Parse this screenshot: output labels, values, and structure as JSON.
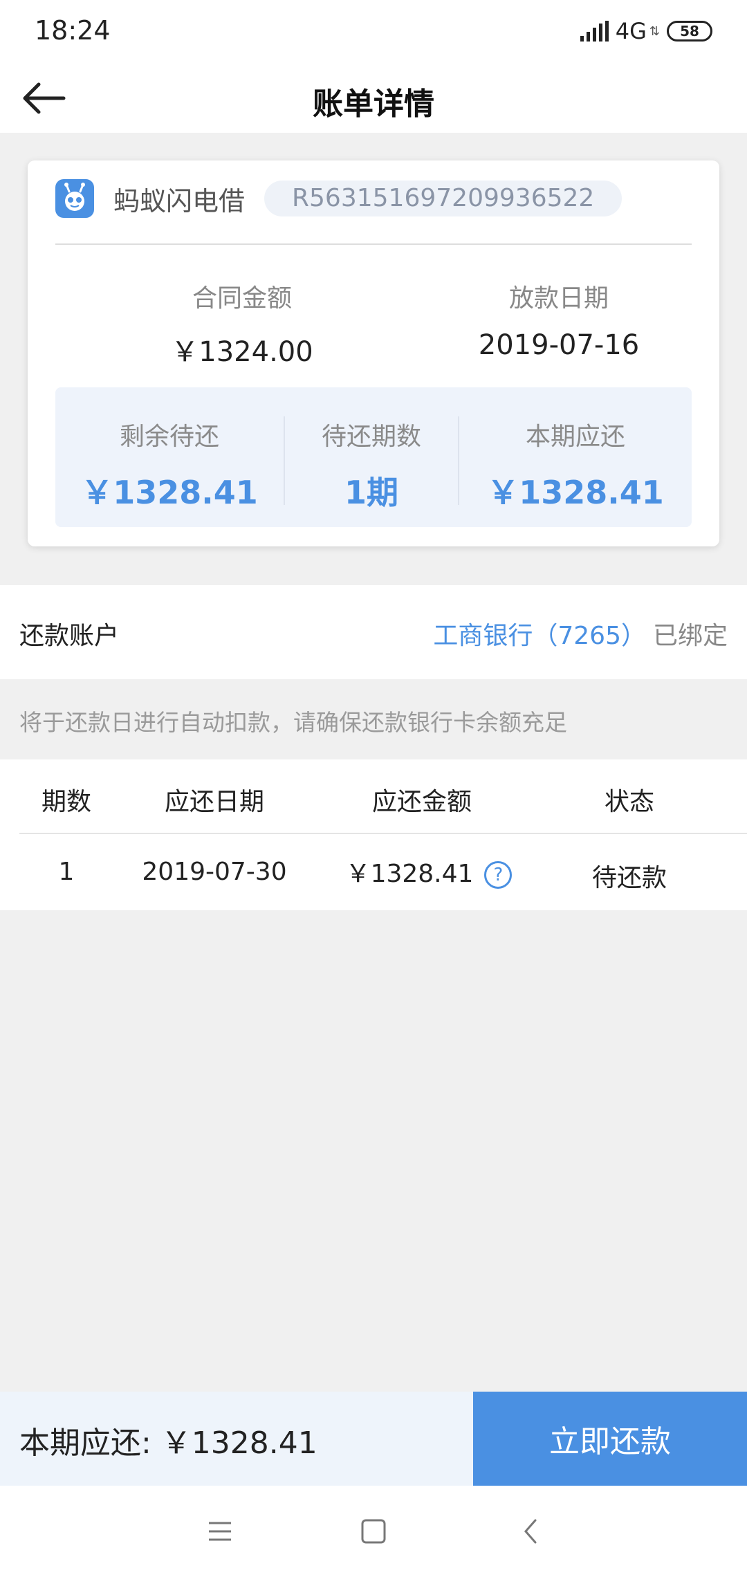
{
  "status_bar": {
    "time": "18:24",
    "network": "4G",
    "network_arrows": "⇅",
    "battery": "58"
  },
  "header": {
    "back_icon": "arrow-left-icon",
    "title": "账单详情"
  },
  "card": {
    "app_icon": "ant-logo-icon",
    "lender": "蚂蚁闪电借",
    "contract_no": "R563151697209936522",
    "contract_amount_label": "合同金额",
    "contract_amount_value": "￥1324.00",
    "loan_date_label": "放款日期",
    "loan_date_value": "2019-07-16",
    "summary": {
      "remaining_label": "剩余待还",
      "remaining_value": "￥1328.41",
      "periods_label": "待还期数",
      "periods_value": "1期",
      "due_label": "本期应还",
      "due_value": "￥1328.41"
    }
  },
  "account": {
    "label": "还款账户",
    "bank": "工商银行（7265）",
    "status": "已绑定"
  },
  "notice": "将于还款日进行自动扣款，请确保还款银行卡余额充足",
  "table": {
    "headers": [
      "期数",
      "应还日期",
      "应还金额",
      "状态"
    ],
    "rows": [
      {
        "period": "1",
        "date": "2019-07-30",
        "amount": "￥1328.41",
        "status": "待还款"
      }
    ],
    "help_icon": "question-circle-icon"
  },
  "bottom_bar": {
    "amount_text": "本期应还: ￥1328.41",
    "button_label": "立即还款"
  },
  "colors": {
    "accent": "#4a90e2",
    "background": "#f0f0f0",
    "summary_bg": "#eef3fb"
  }
}
